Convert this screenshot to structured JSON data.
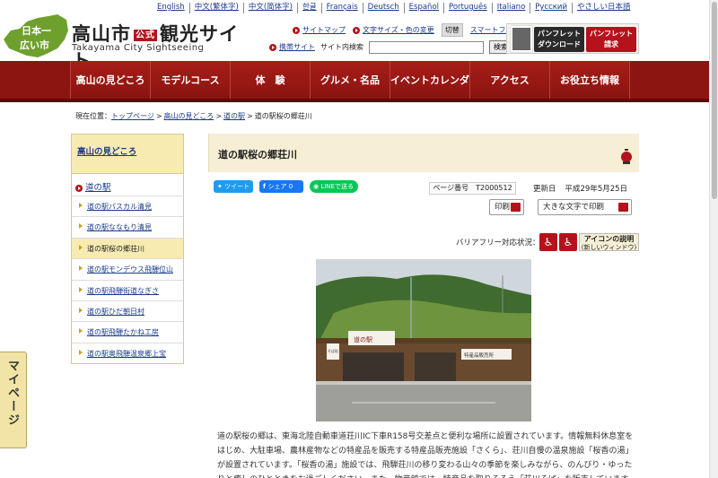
{
  "languages": [
    "English",
    "中文(繁体字)",
    "中文(简体字)",
    "한글",
    "Français",
    "Deutsch",
    "Español",
    "Português",
    "Italiano",
    "Русский",
    "やさしい日本語"
  ],
  "header": {
    "badge_line1": "日本一",
    "badge_line2": "広い市",
    "title": "高山市",
    "title_badge": "公式",
    "title_rest": "観光サイト",
    "subtitle": "Takayama City Sightseeing",
    "sitemap": "サイトマップ",
    "textsize": "文字サイズ・色の変更",
    "kirikae": "切替",
    "smartphone": "スマートフォン",
    "mobile": "携帯サイト",
    "search_label": "サイト内検索",
    "search_button": "検索",
    "search_value": "",
    "pamphlet_download": [
      "パンフレット",
      "ダウンロード"
    ],
    "pamphlet_request": [
      "パンフレット",
      "請求"
    ]
  },
  "nav": [
    "高山の見どころ",
    "モデルコース",
    "体　験",
    "グルメ・名品",
    "イベントカレンダー",
    "アクセス",
    "お役立ち情報"
  ],
  "breadcrumb": {
    "label": "現在位置：",
    "items": [
      "トップページ",
      "高山の見どころ",
      "道の駅"
    ],
    "current": "道の駅桜の郷荘川"
  },
  "sidebar": {
    "heading": "高山の見どころ",
    "category": "道の駅",
    "items": [
      {
        "label": "道の駅パスカル清見",
        "active": false
      },
      {
        "label": "道の駅ななもり清見",
        "active": false
      },
      {
        "label": "道の駅桜の郷荘川",
        "active": true
      },
      {
        "label": "道の駅モンデウス飛騨位山",
        "active": false
      },
      {
        "label": "道の駅飛騨街道なぎさ",
        "active": false
      },
      {
        "label": "道の駅ひだ朝日村",
        "active": false
      },
      {
        "label": "道の駅飛騨たかね工房",
        "active": false
      },
      {
        "label": "道の駅奥飛騨温泉郷上宝",
        "active": false
      }
    ]
  },
  "mypage": "マイページ",
  "page": {
    "title": "道の駅桜の郷荘川",
    "tweet": "ツイート",
    "share": "シェア 0",
    "line": "LINEで送る",
    "page_no": "ページ番号　T2000512",
    "updated_label": "更新日",
    "updated_date": "平成29年5月25日",
    "print": "印刷",
    "print_large": "大きな文字で印刷",
    "barrier_label": "バリアフリー対応状況：",
    "icon_help_1": "アイコンの説明",
    "icon_help_2": "(新しいウィンドウ)",
    "paragraph": "道の駅桜の郷は、東海北陸自動車道荘川IC下車R158号交差点と便利な場所に設置されています。情報無料休息室をはじめ、大駐車場、農林産物などの特産品を販売する特産品販売施設「さくら」、荘川自慢の温泉施設「桜香の湯」が設置されています。「桜香の湯」施設では、飛騨荘川の移り変わる山々の季節を楽しみながら、のんびり・ゆったりと癒しのひとときをお過ごしください。また、物産館では、特産品を取りそろえ「荘川そば」を販売しています。",
    "photo_signs": [
      "道の駅",
      "そば処",
      "特産品販売所"
    ]
  },
  "colors": {
    "brand_red": "#8c1512",
    "sidebar_yellow": "#f7ebb2",
    "title_bg": "#f6efd6",
    "link": "#1a3a8f"
  }
}
